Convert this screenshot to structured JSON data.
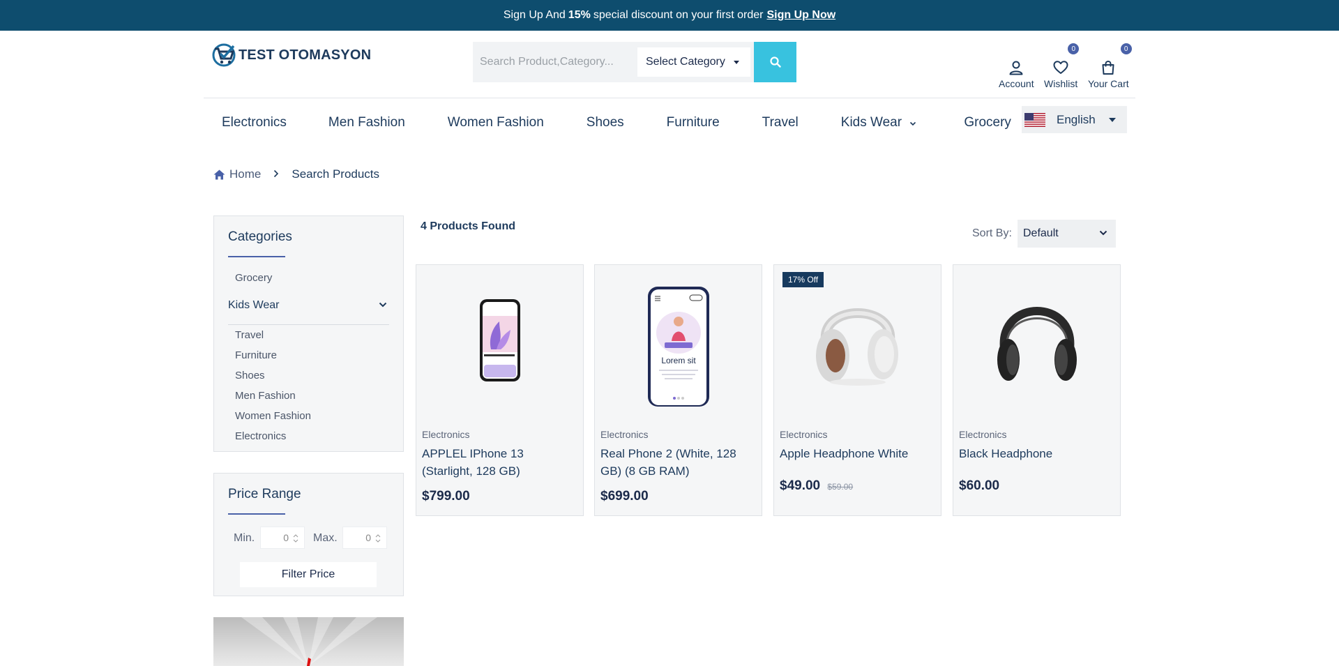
{
  "announcement": {
    "prefix": "Sign Up And",
    "percent": "15%",
    "suffix": "special discount on your first order",
    "link": "Sign Up Now"
  },
  "logo": {
    "text": "TEST OTOMASYON"
  },
  "search": {
    "placeholder": "Search Product,Category...",
    "category_value": "Select Category",
    "button_icon": "search-icon"
  },
  "header_icons": [
    {
      "label": "Account",
      "icon": "user-icon"
    },
    {
      "label": "Wishlist",
      "icon": "heart-icon",
      "badge": "0"
    },
    {
      "label": "Your Cart",
      "icon": "bag-icon",
      "badge": "0"
    }
  ],
  "nav": [
    "Electronics",
    "Men Fashion",
    "Women Fashion",
    "Shoes",
    "Furniture",
    "Travel",
    "Kids Wear",
    "Grocery"
  ],
  "language": {
    "value": "English",
    "flag": "us-flag-icon"
  },
  "breadcrumb": {
    "home": "Home",
    "current": "Search Products"
  },
  "categories": {
    "title": "Categories",
    "top": "Grocery",
    "expanded": "Kids Wear",
    "items": [
      "Travel",
      "Furniture",
      "Shoes",
      "Men Fashion",
      "Women Fashion",
      "Electronics"
    ]
  },
  "price_range": {
    "title": "Price Range",
    "min_label": "Min.",
    "max_label": "Max.",
    "min_value": "0",
    "max_value": "0",
    "button": "Filter Price"
  },
  "results": {
    "count_text": "4 Products Found",
    "sort_label": "Sort By:",
    "sort_value": "Default"
  },
  "products": [
    {
      "category": "Electronics",
      "name": "APPLEL IPhone 13 (Starlight, 128 GB)",
      "price": "$799.00",
      "image": "iphone-image"
    },
    {
      "category": "Electronics",
      "name": "Real Phone 2 (White, 128 GB) (8 GB RAM)",
      "price": "$699.00",
      "image": "phone-image",
      "screen_text": "Lorem sit"
    },
    {
      "category": "Electronics",
      "name": "Apple Headphone White",
      "price": "$49.00",
      "old_price": "$59.00",
      "discount": "17% Off",
      "image": "white-headphone-image"
    },
    {
      "category": "Electronics",
      "name": "Black Headphone",
      "price": "$60.00",
      "image": "black-headphone-image"
    }
  ],
  "colors": {
    "topbar": "#0e4d6e",
    "accent": "#38c2df",
    "badge": "#4961a8",
    "text": "#1d3a5c"
  }
}
